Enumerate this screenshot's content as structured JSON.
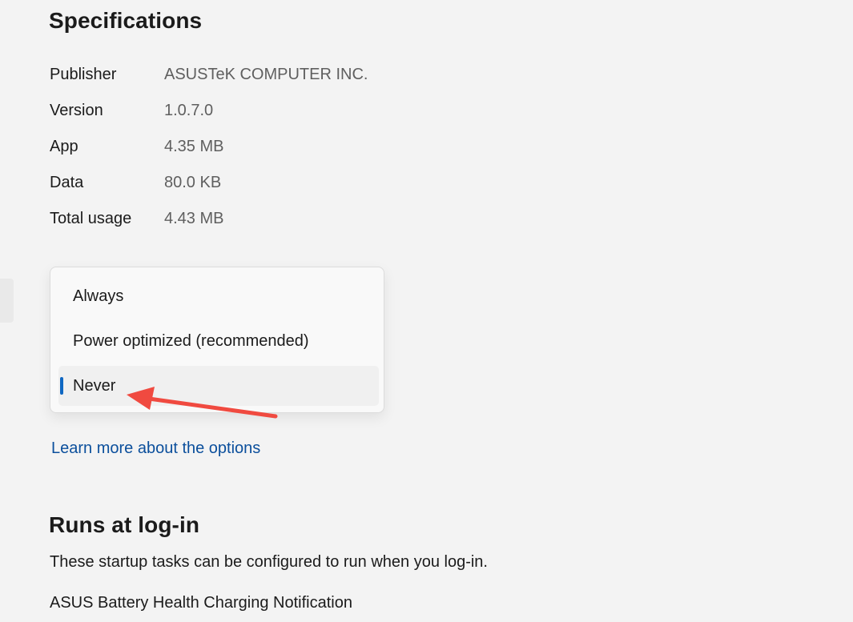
{
  "specifications": {
    "title": "Specifications",
    "rows": [
      {
        "label": "Publisher",
        "value": "ASUSTeK COMPUTER INC."
      },
      {
        "label": "Version",
        "value": "1.0.7.0"
      },
      {
        "label": "App",
        "value": "4.35 MB"
      },
      {
        "label": "Data",
        "value": "80.0 KB"
      },
      {
        "label": "Total usage",
        "value": "4.43 MB"
      }
    ]
  },
  "background_permissions": {
    "options": [
      {
        "label": "Always",
        "selected": false
      },
      {
        "label": "Power optimized (recommended)",
        "selected": false
      },
      {
        "label": "Never",
        "selected": true
      }
    ],
    "accent_color": "#0f67c2",
    "learn_more_link": "Learn more about the options"
  },
  "runs_at_login": {
    "title": "Runs at log-in",
    "description": "These startup tasks can be configured to run when you log-in.",
    "tasks": [
      "ASUS Battery Health Charging Notification"
    ]
  },
  "annotation": {
    "arrow_color": "#f04a40",
    "points_to": "Never"
  }
}
